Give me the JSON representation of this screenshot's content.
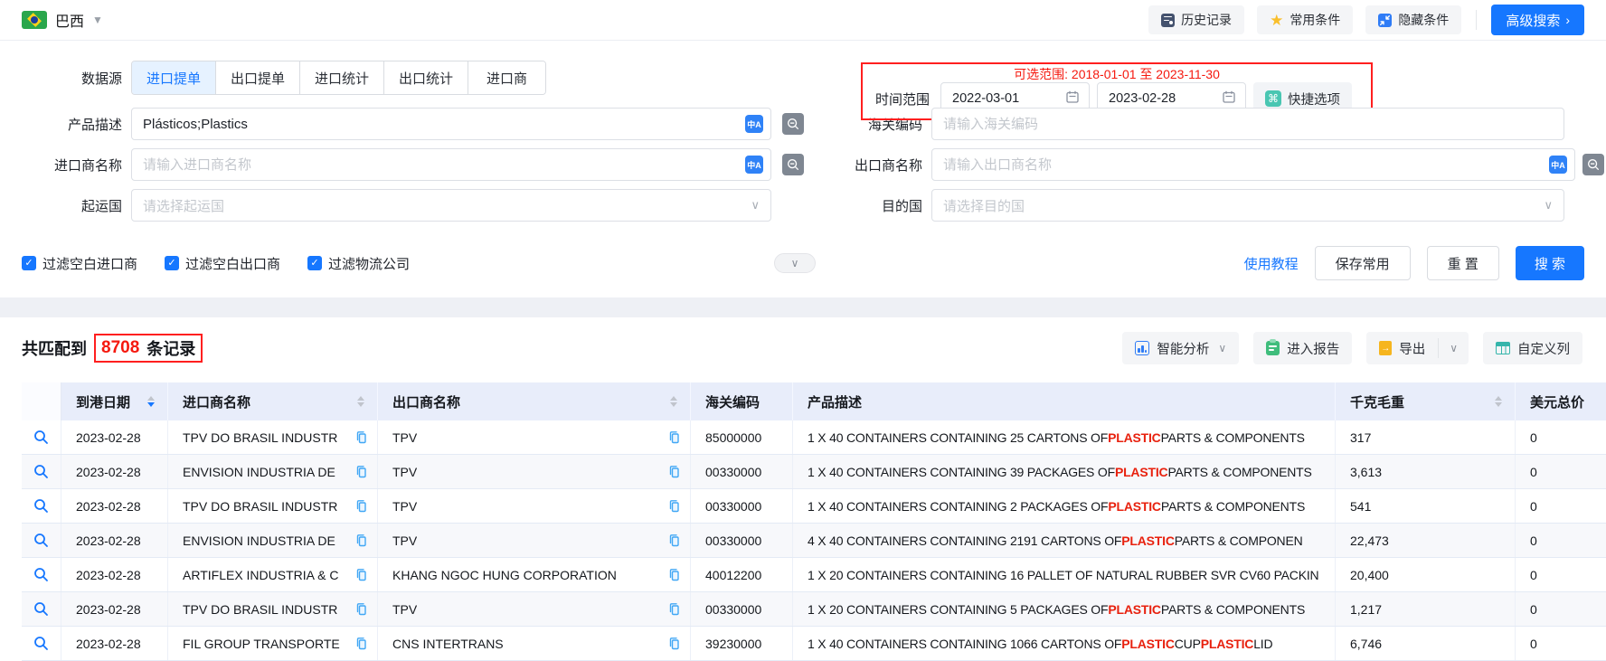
{
  "topbar": {
    "country": "巴西",
    "history_btn": "历史记录",
    "favorite_btn": "常用条件",
    "hide_btn": "隐藏条件",
    "advanced_btn": "高级搜索"
  },
  "form": {
    "datasource_label": "数据源",
    "tabs": [
      {
        "label": "进口提单",
        "active": true
      },
      {
        "label": "出口提单",
        "active": false
      },
      {
        "label": "进口统计",
        "active": false
      },
      {
        "label": "出口统计",
        "active": false
      },
      {
        "label": "进口商",
        "active": false
      }
    ],
    "time": {
      "hint": "可选范围: 2018-01-01 至 2023-11-30",
      "label": "时间范围",
      "start": "2022-03-01",
      "end": "2023-02-28",
      "quick_btn": "快捷选项"
    },
    "fields": {
      "product": {
        "label": "产品描述",
        "value": "Plásticos;Plastics"
      },
      "hscode": {
        "label": "海关编码",
        "placeholder": "请输入海关编码"
      },
      "importer": {
        "label": "进口商名称",
        "placeholder": "请输入进口商名称"
      },
      "exporter": {
        "label": "出口商名称",
        "placeholder": "请输入出口商名称"
      },
      "origin": {
        "label": "起运国",
        "placeholder": "请选择起运国"
      },
      "destination": {
        "label": "目的国",
        "placeholder": "请选择目的国"
      }
    },
    "checkboxes": [
      {
        "label": "过滤空白进口商",
        "checked": true
      },
      {
        "label": "过滤空白出口商",
        "checked": true
      },
      {
        "label": "过滤物流公司",
        "checked": true
      }
    ],
    "actions": {
      "tutorial_link": "使用教程",
      "save_btn": "保存常用",
      "reset_btn": "重 置",
      "search_btn": "搜 索"
    }
  },
  "results": {
    "title_prefix": "共匹配到",
    "count": "8708",
    "title_suffix": "条记录",
    "toolbar": {
      "analysis_btn": "智能分析",
      "report_btn": "进入报告",
      "export_btn": "导出",
      "custom_columns_btn": "自定义列"
    }
  },
  "table": {
    "highlight_term": "PLASTIC",
    "columns": [
      {
        "label": "",
        "sortable": false
      },
      {
        "label": "到港日期",
        "sortable": true,
        "sort": "desc"
      },
      {
        "label": "进口商名称",
        "sortable": true
      },
      {
        "label": "出口商名称",
        "sortable": true
      },
      {
        "label": "海关编码",
        "sortable": false
      },
      {
        "label": "产品描述",
        "sortable": false
      },
      {
        "label": "千克毛重",
        "sortable": true
      },
      {
        "label": "美元总价",
        "sortable": false
      }
    ],
    "rows": [
      {
        "date": "2023-02-28",
        "importer": "TPV DO BRASIL INDUSTR",
        "exporter": "TPV",
        "hscode": "85000000",
        "desc": "1 X 40 CONTAINERS CONTAINING 25 CARTONS OF PLASTIC PARTS & COMPONENTS",
        "weight": "317",
        "usd": "0"
      },
      {
        "date": "2023-02-28",
        "importer": "ENVISION INDUSTRIA DE",
        "exporter": "TPV",
        "hscode": "00330000",
        "desc": "1 X 40 CONTAINERS CONTAINING 39 PACKAGES OF PLASTIC PARTS & COMPONENTS",
        "weight": "3,613",
        "usd": "0"
      },
      {
        "date": "2023-02-28",
        "importer": "TPV DO BRASIL INDUSTR",
        "exporter": "TPV",
        "hscode": "00330000",
        "desc": "1 X 40 CONTAINERS CONTAINING 2 PACKAGES OF PLASTIC PARTS & COMPONENTS",
        "weight": "541",
        "usd": "0"
      },
      {
        "date": "2023-02-28",
        "importer": "ENVISION INDUSTRIA DE",
        "exporter": "TPV",
        "hscode": "00330000",
        "desc": "4 X 40 CONTAINERS CONTAINING 2191 CARTONS OF PLASTIC PARTS & COMPONEN",
        "weight": "22,473",
        "usd": "0"
      },
      {
        "date": "2023-02-28",
        "importer": "ARTIFLEX INDUSTRIA & C",
        "exporter": "KHANG NGOC HUNG CORPORATION",
        "hscode": "40012200",
        "desc": "1 X 20 CONTAINERS CONTAINING 16 PALLET OF NATURAL RUBBER SVR CV60 PACKIN",
        "weight": "20,400",
        "usd": "0"
      },
      {
        "date": "2023-02-28",
        "importer": "TPV DO BRASIL INDUSTR",
        "exporter": "TPV",
        "hscode": "00330000",
        "desc": "1 X 20 CONTAINERS CONTAINING 5 PACKAGES OF PLASTIC PARTS & COMPONENTS",
        "weight": "1,217",
        "usd": "0"
      },
      {
        "date": "2023-02-28",
        "importer": "FIL GROUP TRANSPORTE",
        "exporter": "CNS INTERTRANS",
        "hscode": "39230000",
        "desc": "1 X 40 CONTAINERS CONTAINING 1066 CARTONS OF PLASTIC CUP PLASTIC LID",
        "weight": "6,746",
        "usd": "0"
      }
    ]
  }
}
